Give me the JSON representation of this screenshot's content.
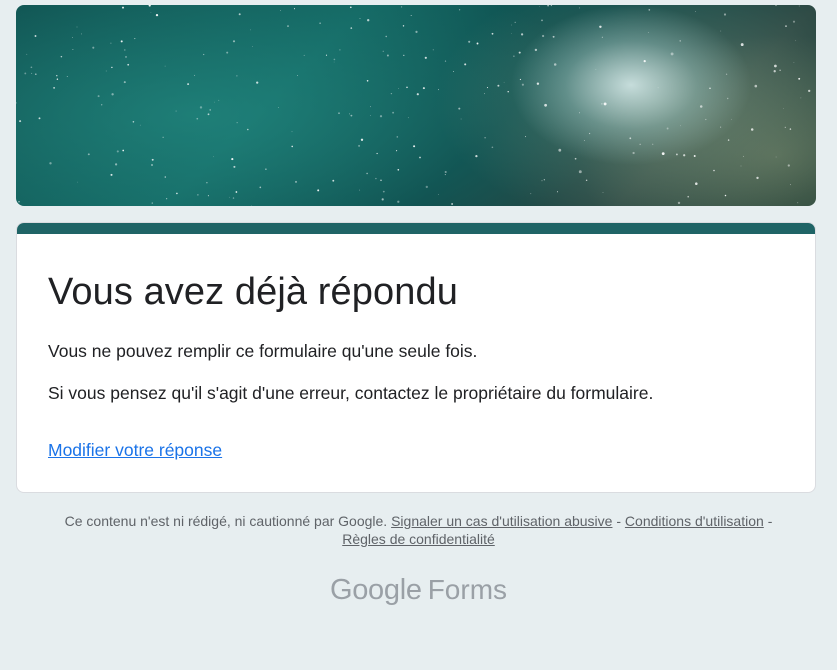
{
  "header": {
    "banner_image": "starry-milky-way-banner"
  },
  "card": {
    "accent_color": "#1f6466",
    "title": "Vous avez déjà répondu",
    "message_1": "Vous ne pouvez remplir ce formulaire qu'une seule fois.",
    "message_2": "Si vous pensez qu'il s'agit d'une erreur, contactez le propriétaire du formulaire.",
    "edit_link": "Modifier votre réponse"
  },
  "footer": {
    "disclaimer": "Ce contenu n'est ni rédigé, ni cautionné par Google.",
    "report_abuse": "Signaler un cas d'utilisation abusive",
    "sep_1": "-",
    "terms": "Conditions d'utilisation",
    "sep_2": "-",
    "privacy": "Règles de confidentialité"
  },
  "brand": {
    "google": "Google",
    "product": "Forms"
  }
}
